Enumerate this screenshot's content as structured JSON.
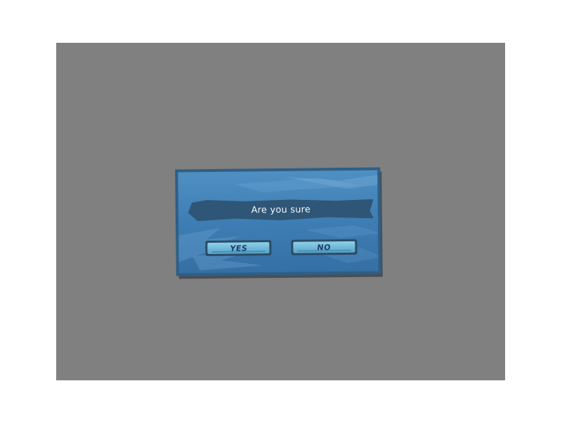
{
  "dialog": {
    "message": "Are you sure",
    "yes_label": "YES",
    "no_label": "NO"
  },
  "colors": {
    "overlay": "#808080",
    "panel": "#3f7fb5",
    "panel_border": "#2e5f86",
    "banner": "#2f5676",
    "button": "#6cb5d8",
    "button_text": "#1f3d6b"
  }
}
